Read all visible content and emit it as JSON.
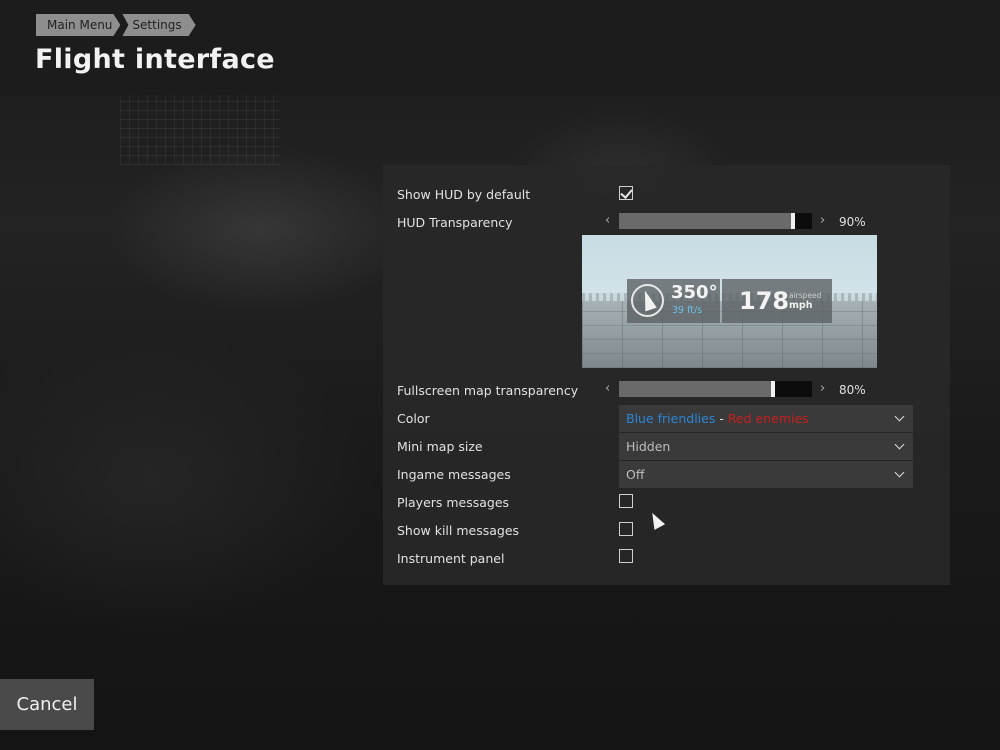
{
  "breadcrumb": [
    "Main Menu",
    "Settings"
  ],
  "page_title": "Flight interface",
  "settings": {
    "show_hud": {
      "label": "Show HUD by default",
      "checked": true
    },
    "hud_transparency": {
      "label": "HUD Transparency",
      "value_text": "90%",
      "value": 0.9
    },
    "preview": {
      "heading": "350°",
      "climb": "39 ft/s",
      "speed": "178",
      "speed_label": "airspeed",
      "speed_unit": "mph"
    },
    "map_transparency": {
      "label": "Fullscreen map transparency",
      "value_text": "80%",
      "value": 0.8
    },
    "color": {
      "label": "Color",
      "friendly": "Blue friendlies",
      "separator": " - ",
      "enemy": "Red enemies",
      "friendly_color": "#2b86d6",
      "enemy_color": "#c81e1e"
    },
    "minimap": {
      "label": "Mini map size",
      "value": "Hidden"
    },
    "ingame_messages": {
      "label": "Ingame messages",
      "value": "Off"
    },
    "players_messages": {
      "label": "Players messages",
      "checked": false
    },
    "kill_messages": {
      "label": "Show kill messages",
      "checked": false
    },
    "instrument_panel": {
      "label": "Instrument panel",
      "checked": false
    }
  },
  "slider_arrows": {
    "left": "‹",
    "right": "›"
  },
  "cancel_label": "Cancel"
}
